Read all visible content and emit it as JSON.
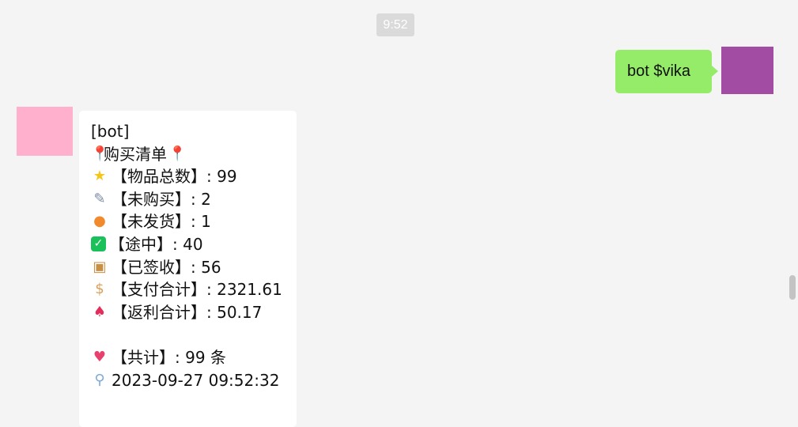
{
  "timestamp": "9:52",
  "outgoing": {
    "text": "bot $vika",
    "bubble_color": "#95ec69",
    "avatar_color": "#a34ca3"
  },
  "incoming": {
    "avatar_color": "#ffb0cd",
    "header": "[bot]",
    "list_title": "购买清单",
    "title_icon": "pin-icon",
    "rows": [
      {
        "icon": "star-icon",
        "glyph": "★",
        "text": "【物品总数】: 99"
      },
      {
        "icon": "memo-icon",
        "glyph": "✎",
        "text": "【未购买】: 2"
      },
      {
        "icon": "peach-icon",
        "glyph": "●",
        "text": "【未发货】: 1"
      },
      {
        "icon": "check-icon",
        "glyph": "✓",
        "text": "【途中】: 40"
      },
      {
        "icon": "package-icon",
        "glyph": "▣",
        "text": "【已签收】: 56"
      },
      {
        "icon": "money-bag-icon",
        "glyph": "$",
        "text": "【支付合计】: 2321.61"
      },
      {
        "icon": "tulip-icon",
        "glyph": "♠",
        "text": "【返利合计】: 50.17"
      }
    ],
    "total": {
      "icon": "hearts-icon",
      "glyph": "♥",
      "text": "【共计】:  99 条"
    },
    "datetime": {
      "icon": "pushpin-icon",
      "glyph": "⚲",
      "text": "2023-09-27 09:52:32"
    }
  }
}
